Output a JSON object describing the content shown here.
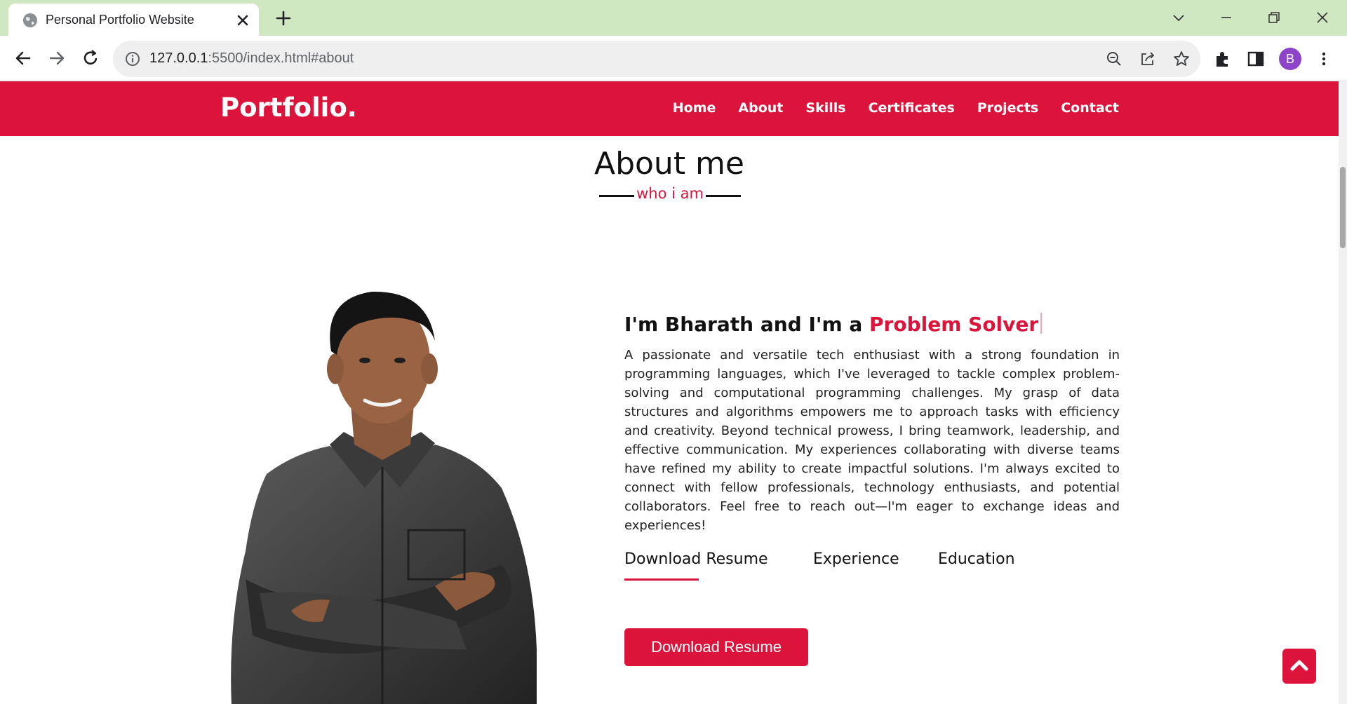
{
  "browser": {
    "tab_title": "Personal Portfolio Website",
    "url_host": "127.0.0.1",
    "url_rest": ":5500/index.html#about",
    "profile_initial": "B",
    "accent_color": "#cfe8c1"
  },
  "navbar": {
    "logo": "Portfolio.",
    "items": [
      "Home",
      "About",
      "Skills",
      "Certificates",
      "Projects",
      "Contact"
    ],
    "bg_color": "#dc143c"
  },
  "about": {
    "title": "About me",
    "subtitle": "who i am",
    "intro_prefix": "I'm Bharath and I'm a ",
    "intro_role": "Problem Solver",
    "bio": "A passionate and versatile tech enthusiast with a strong foundation in programming languages, which I've leveraged to tackle complex problem-solving and computational programming challenges. My grasp of data structures and algorithms empowers me to approach tasks with efficiency and creativity. Beyond technical prowess, I bring teamwork, leadership, and effective communication. My experiences collaborating with diverse teams have refined my ability to create impactful solutions. I'm always excited to connect with fellow professionals, technology enthusiasts, and potential collaborators. Feel free to reach out—I'm eager to exchange ideas and experiences!",
    "tabs": [
      "Download Resume",
      "Experience",
      "Education"
    ],
    "active_tab": "Download Resume",
    "download_button": "Download Resume"
  },
  "icons": {
    "tab_favicon": "globe-icon",
    "scroll_top": "chevron-up-icon"
  }
}
